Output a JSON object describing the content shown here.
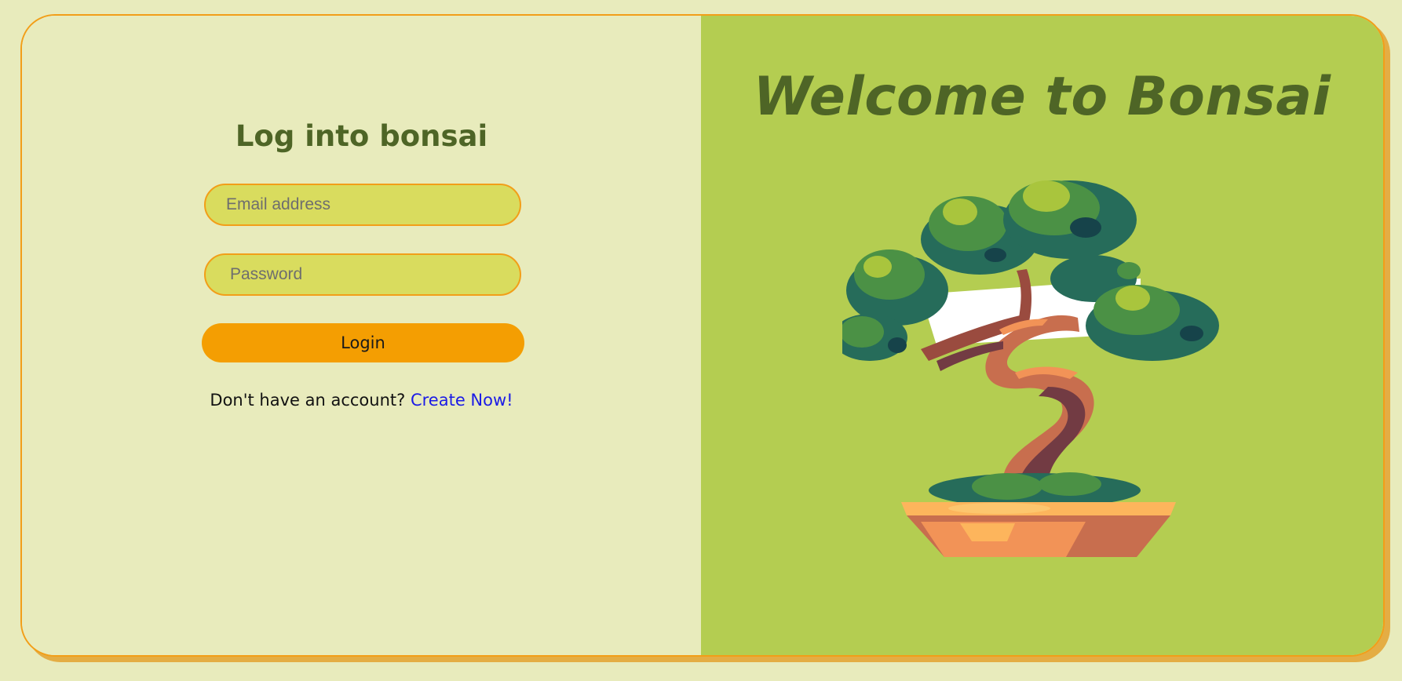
{
  "login": {
    "title": "Log into bonsai",
    "email_placeholder": "Email address",
    "password_placeholder": "Password",
    "login_button": "Login",
    "signup_prompt": "Don't have an account?",
    "signup_link": "Create Now!"
  },
  "hero": {
    "title": "Welcome to Bonsai",
    "illustration": "bonsai-tree-illustration"
  },
  "colors": {
    "page_background": "#e8ebbc",
    "hero_background": "#b4cd51",
    "accent_orange": "#f49e02",
    "input_background": "#d9dc5e",
    "heading_green": "#4e6526",
    "link_blue": "#1b1be6"
  }
}
